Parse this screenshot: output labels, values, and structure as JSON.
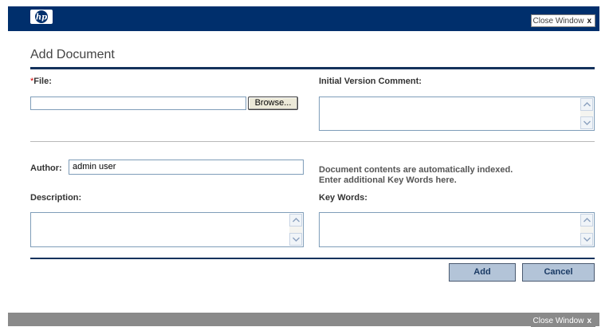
{
  "header": {
    "logo_alt": "hp",
    "close_window_label": "Close Window",
    "close_icon_glyph": "x"
  },
  "page": {
    "title": "Add Document"
  },
  "file_section": {
    "required_marker": "*",
    "file_label": "File:",
    "file_value": "",
    "browse_label": "Browse...",
    "comment_label": "Initial Version Comment:",
    "comment_value": ""
  },
  "details_section": {
    "author_label": "Author:",
    "author_value": "admin user",
    "index_note_line1": "Document contents are automatically indexed.",
    "index_note_line2": "Enter additional Key Words here.",
    "description_label": "Description:",
    "description_value": "",
    "keywords_label": "Key Words:",
    "keywords_value": ""
  },
  "actions": {
    "add_label": "Add",
    "cancel_label": "Cancel"
  },
  "footer": {
    "close_window_label": "Close Window",
    "close_icon_glyph": "x"
  },
  "colors": {
    "header_bg": "#002f6c",
    "accent_rule": "#14325c",
    "button_bg": "#b3c4d8",
    "required": "#d40000",
    "footer_bg": "#8a8a8a"
  }
}
